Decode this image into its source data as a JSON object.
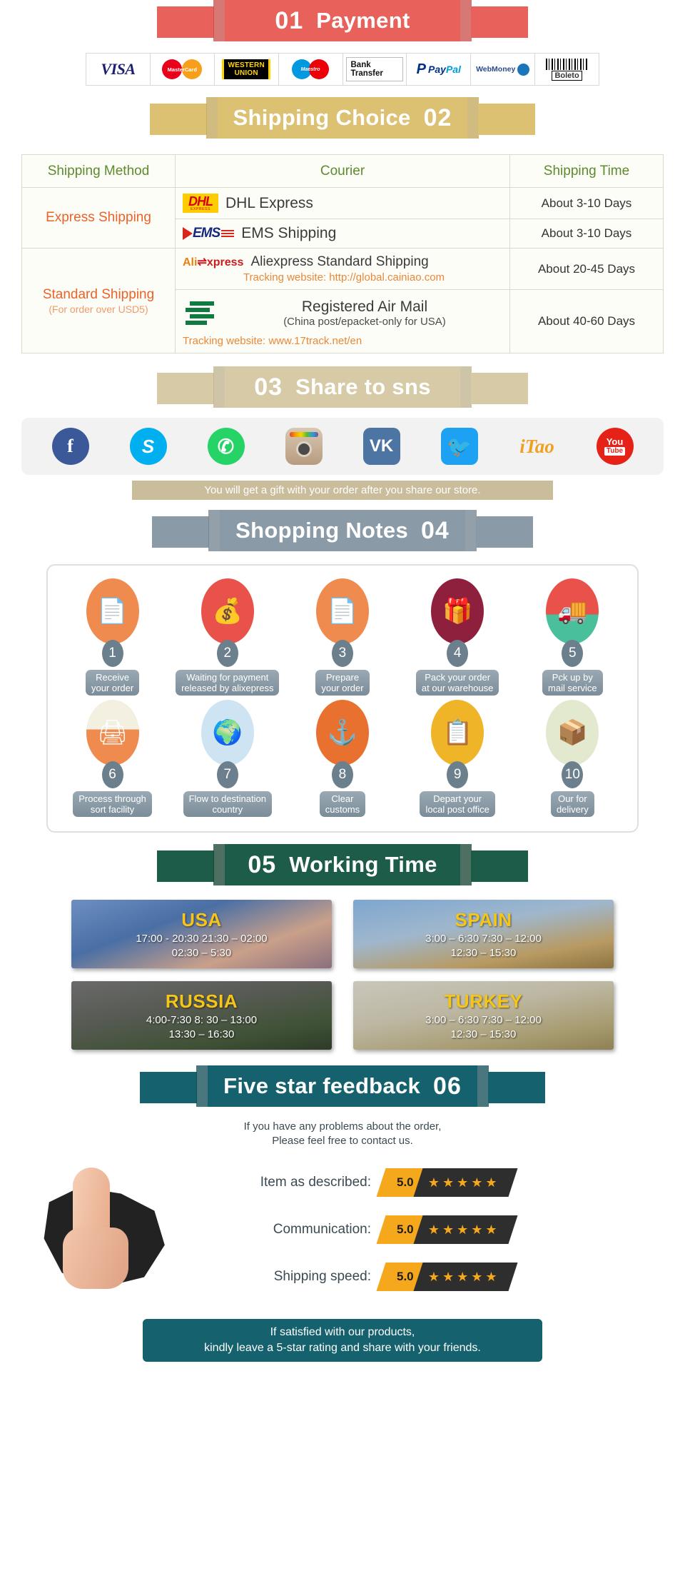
{
  "sections": {
    "payment": {
      "num": "01",
      "title": "Payment",
      "num_side": "left",
      "color": "#e8615a",
      "fold": "#c84c46"
    },
    "shipping": {
      "num": "02",
      "title": "Shipping Choice",
      "num_side": "right",
      "color": "#dcc173",
      "fold": "#c2a css"
    },
    "share": {
      "num": "03",
      "title": "Share to sns",
      "num_side": "left",
      "color": "#d6cba6",
      "fold": "#bdb08a"
    },
    "notes": {
      "num": "04",
      "title": "Shopping Notes",
      "num_side": "right",
      "color": "#8a9aa6",
      "fold": "#6f808c"
    },
    "working": {
      "num": "05",
      "title": "Working Time",
      "num_side": "left",
      "color": "#1c5c48",
      "fold": "#144435"
    },
    "feedback": {
      "num": "06",
      "title": "Five star feedback",
      "num_side": "right",
      "color": "#15616d",
      "fold": "#0e4a53"
    }
  },
  "payment_methods": [
    {
      "name": "visa-logo",
      "label": "VISA"
    },
    {
      "name": "mastercard-logo",
      "label": "MasterCard"
    },
    {
      "name": "western-union-logo",
      "label": "WESTERN UNION",
      "line1": "WESTERN",
      "line2": "UNION"
    },
    {
      "name": "maestro-logo",
      "label": "Maestro"
    },
    {
      "name": "bank-transfer-logo",
      "label": "Bank Transfer"
    },
    {
      "name": "paypal-logo",
      "label": "PayPal",
      "mark": "P",
      "part1": "Pay",
      "part2": "Pal"
    },
    {
      "name": "webmoney-logo",
      "label": "WebMoney"
    },
    {
      "name": "boleto-logo",
      "label": "Boleto"
    }
  ],
  "shipping_table": {
    "headers": [
      "Shipping Method",
      "Courier",
      "Shipping Time"
    ],
    "rows": [
      {
        "method": "Express Shipping",
        "method_sub": "",
        "courier": "DHL Express",
        "logo": "dhl-logo",
        "logo_text": "DHL",
        "logo_sub": "EXPRESS",
        "time": "About 3-10 Days",
        "track": ""
      },
      {
        "method": "",
        "method_sub": "",
        "courier": "EMS Shipping",
        "logo": "ems-logo",
        "logo_text": "EMS",
        "logo_sub": "",
        "time": "About 3-10 Days",
        "track": ""
      },
      {
        "method": "Standard Shipping",
        "method_sub": "(For order over USD5)",
        "courier": "Aliexpress Standard Shipping",
        "logo": "aliexpress-logo",
        "logo_text": "Ali",
        "logo_sub": "xpress",
        "time": "About 20-45 Days",
        "track": "Tracking website: http://global.cainiao.com"
      },
      {
        "method": "",
        "method_sub": "",
        "courier": "Registered Air Mail",
        "courier_sub": "(China post/epacket-only for USA)",
        "logo": "china-post-logo",
        "logo_text": "",
        "logo_sub": "",
        "time": "About 40-60 Days",
        "track": "Tracking website: www.17track.net/en"
      }
    ]
  },
  "social_icons": [
    {
      "name": "facebook-icon",
      "glyph": "f",
      "label": "Facebook"
    },
    {
      "name": "skype-icon",
      "glyph": "S",
      "label": "Skype"
    },
    {
      "name": "whatsapp-icon",
      "glyph": "✆",
      "label": "WhatsApp"
    },
    {
      "name": "instagram-icon",
      "glyph": "",
      "label": "Instagram"
    },
    {
      "name": "vk-icon",
      "glyph": "VK",
      "label": "VK"
    },
    {
      "name": "twitter-icon",
      "glyph": "🐦",
      "label": "Twitter"
    },
    {
      "name": "itao-icon",
      "glyph": "iTao",
      "label": "iTao"
    },
    {
      "name": "youtube-icon",
      "glyph": "You",
      "label": "YouTube",
      "sub": "Tube"
    }
  ],
  "share_note": "You will get a gift with your order after you share our store.",
  "shopping_notes": [
    {
      "num": "1",
      "label": "Receive\nyour order",
      "icon": "document-hand-icon",
      "color": "#ef8b4e"
    },
    {
      "num": "2",
      "label": "Waiting for payment\nreleased by alixepress",
      "icon": "money-bag-icon",
      "color": "#e8524a"
    },
    {
      "num": "3",
      "label": "Prepare\nyour order",
      "icon": "document-hand-icon",
      "color": "#ef8b4e"
    },
    {
      "num": "4",
      "label": "Pack your order\nat our warehouse",
      "icon": "gift-box-icon",
      "color": "#8e1f3d"
    },
    {
      "num": "5",
      "label": "Pck up by\nmail service",
      "icon": "mail-truck-icon",
      "color": "#e8524a"
    },
    {
      "num": "6",
      "label": "Process through\nsort facility",
      "icon": "sorting-icon",
      "color": "#ef8b4e"
    },
    {
      "num": "7",
      "label": "Flow to destination\ncountry",
      "icon": "globe-icon",
      "color": "#cfe4f2"
    },
    {
      "num": "8",
      "label": "Clear\ncustoms",
      "icon": "anchor-icon",
      "color": "#e8712f"
    },
    {
      "num": "9",
      "label": "Depart your\nlocal post office",
      "icon": "clipboard-icon",
      "color": "#f0b429"
    },
    {
      "num": "10",
      "label": "Our for\ndelivery",
      "icon": "parcel-icon",
      "color": "#e3e9cf"
    }
  ],
  "working_time": [
    {
      "country": "USA",
      "times": "17:00 - 20:30  21:30 – 02:00\n02:30 – 5:30"
    },
    {
      "country": "SPAIN",
      "times": "3:00 – 6:30   7:30 – 12:00\n12:30 – 15:30"
    },
    {
      "country": "RUSSIA",
      "times": "4:00-7:30   8: 30 – 13:00\n13:30 – 16:30"
    },
    {
      "country": "TURKEY",
      "times": "3:00 – 6:30   7:30 – 12:00\n12:30 – 15:30"
    }
  ],
  "feedback": {
    "intro_line1": "If you have any problems about the order,",
    "intro_line2": "Please feel free to contact us.",
    "ratings": [
      {
        "label": "Item as described:",
        "score": "5.0",
        "stars": "★★★★★"
      },
      {
        "label": "Communication:",
        "score": "5.0",
        "stars": "★★★★★"
      },
      {
        "label": "Shipping speed:",
        "score": "5.0",
        "stars": "★★★★★"
      }
    ],
    "banner_line1": "If satisfied with our products,",
    "banner_line2": "kindly leave a 5-star rating and share with your friends."
  }
}
